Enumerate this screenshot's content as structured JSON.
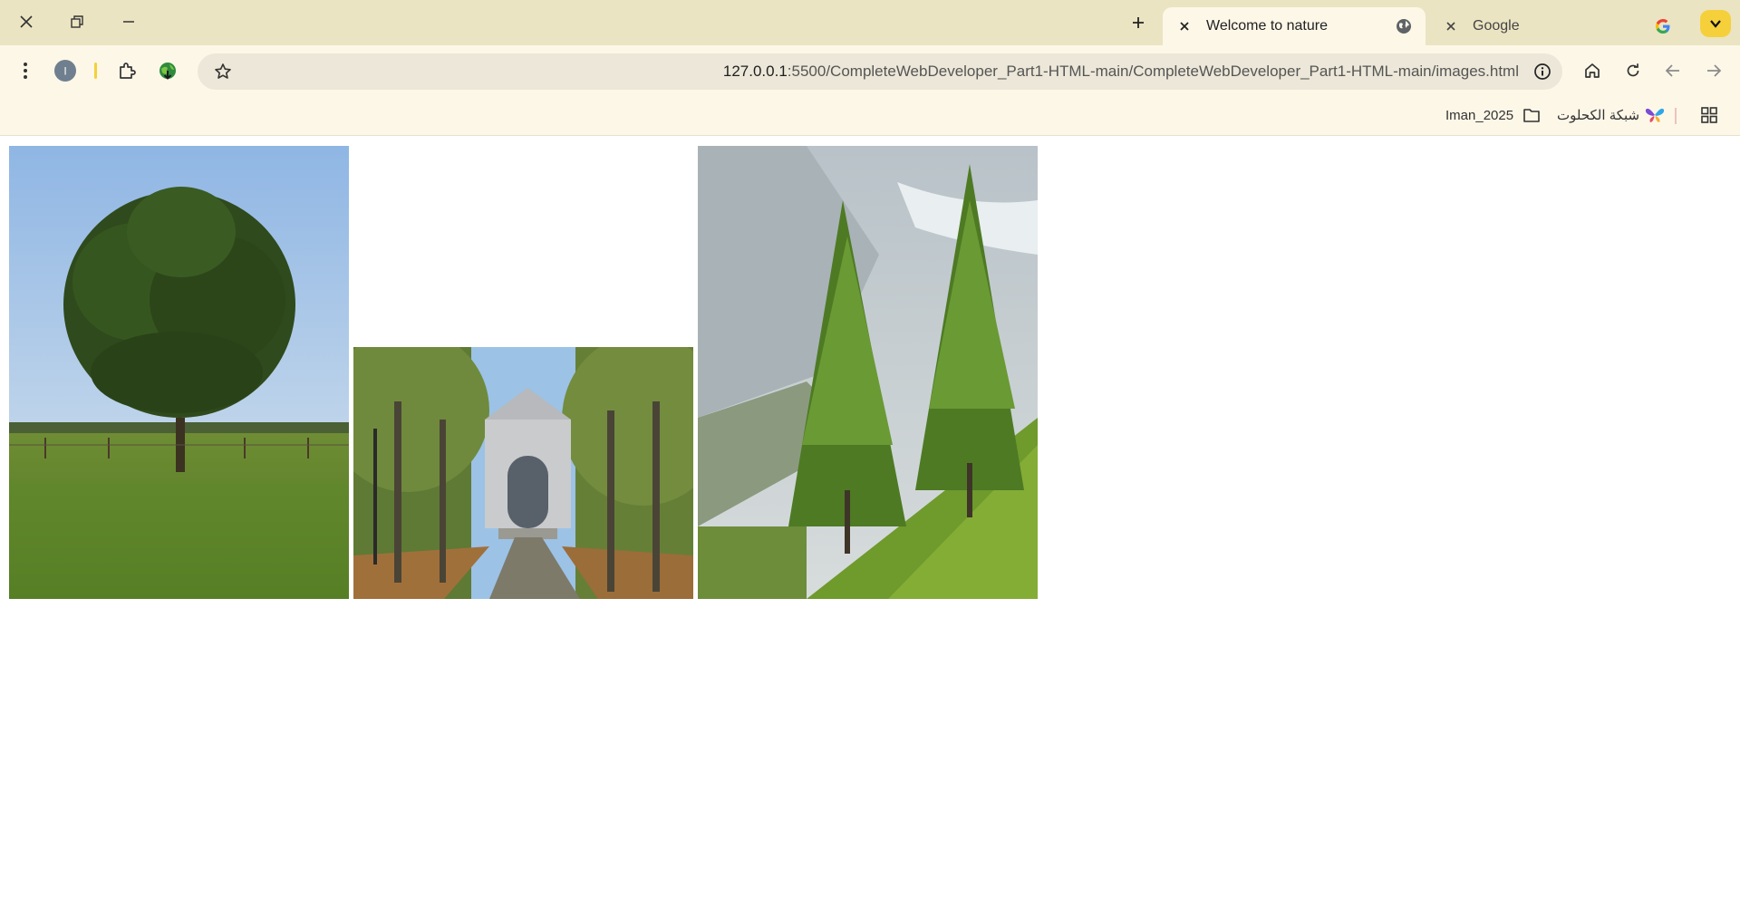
{
  "tabs": [
    {
      "title": "Welcome to nature",
      "active": true,
      "favicon": "globe-icon"
    },
    {
      "title": "Google",
      "active": false,
      "favicon": "google-g-icon"
    }
  ],
  "window_controls": [
    "close-icon",
    "restore-icon",
    "minimize-icon"
  ],
  "toolbar": {
    "profile_initial": "I",
    "url_host": "127.0.0.1",
    "url_rest": ":5500/CompleteWebDeveloper_Part1-HTML-main/CompleteWebDeveloper_Part1-HTML-main/images.html"
  },
  "bookmarks": [
    {
      "label": "شبكة الكحلوت",
      "icon": "butterfly-icon"
    },
    {
      "label": "Iman_2025",
      "icon": "folder-icon"
    }
  ],
  "images": [
    {
      "subject": "tree-in-meadow-photo"
    },
    {
      "subject": "tree-lined-path-to-gate-photo"
    },
    {
      "subject": "larch-trees-mountain-photo"
    }
  ],
  "colors": {
    "tabstrip": "#ebe4c2",
    "toolbar": "#fdf7e7",
    "omnibox": "#ece7d8",
    "accent": "#f5d03b"
  }
}
